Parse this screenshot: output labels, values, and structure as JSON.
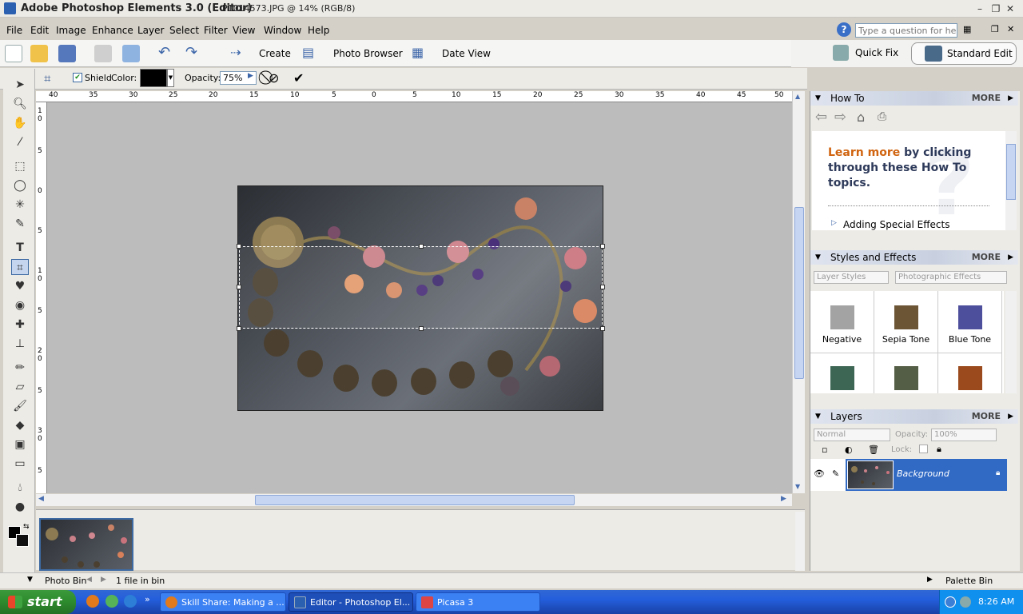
{
  "window": {
    "app_title": "Adobe Photoshop Elements 3.0 (Editor)",
    "doc_title": "P1014573.JPG @ 14% (RGB/8)",
    "help_placeholder": "Type a question for help"
  },
  "menu": [
    "File",
    "Edit",
    "Image",
    "Enhance",
    "Layer",
    "Select",
    "Filter",
    "View",
    "Window",
    "Help"
  ],
  "toolbar": {
    "create_label": "Create",
    "photo_browser_label": "Photo Browser",
    "date_view_label": "Date View",
    "quick_fix_label": "Quick Fix",
    "standard_edit_label": "Standard Edit"
  },
  "options": {
    "shield_label": "Shield",
    "color_label": "Color:",
    "opacity_label": "Opacity:",
    "opacity_value": "75%"
  },
  "ruler": {
    "h_ticks": [
      "40",
      "35",
      "30",
      "25",
      "20",
      "15",
      "10",
      "5",
      "0",
      "5",
      "10",
      "15",
      "20",
      "25",
      "30",
      "35",
      "40",
      "45",
      "50"
    ],
    "v_ticks": [
      "1",
      "0",
      "5",
      "0",
      "5",
      "1",
      "0",
      "5",
      "2",
      "0",
      "5",
      "3",
      "0",
      "5"
    ]
  },
  "howto": {
    "title": "How To",
    "more": "MORE",
    "lead_highlight": "Learn more",
    "lead_rest": " by clicking through these How To topics.",
    "topic": "Adding Special Effects"
  },
  "styles": {
    "title": "Styles and Effects",
    "more": "MORE",
    "dropdown1": "Layer Styles",
    "dropdown2": "Photographic Effects",
    "swatches": [
      {
        "label": "Negative",
        "color": "#a3a3a3"
      },
      {
        "label": "Sepia Tone",
        "color": "#6b5535"
      },
      {
        "label": "Blue Tone",
        "color": "#4e4f9c"
      },
      {
        "label": "",
        "color": "#3e6655"
      },
      {
        "label": "",
        "color": "#545d45"
      },
      {
        "label": "",
        "color": "#9a4a1c"
      }
    ]
  },
  "layers": {
    "title": "Layers",
    "more": "MORE",
    "blend": "Normal",
    "opacity_label": "Opacity:",
    "opacity_value": "100%",
    "lock_label": "Lock:",
    "layer_name": "Background"
  },
  "bin": {
    "label": "Photo Bin",
    "count": "1 file in bin",
    "palette_bin": "Palette Bin"
  },
  "taskbar": {
    "start": "start",
    "tasks": [
      "Skill Share: Making a ...",
      "Editor - Photoshop El...",
      "Picasa 3"
    ],
    "clock": "8:26 AM"
  }
}
